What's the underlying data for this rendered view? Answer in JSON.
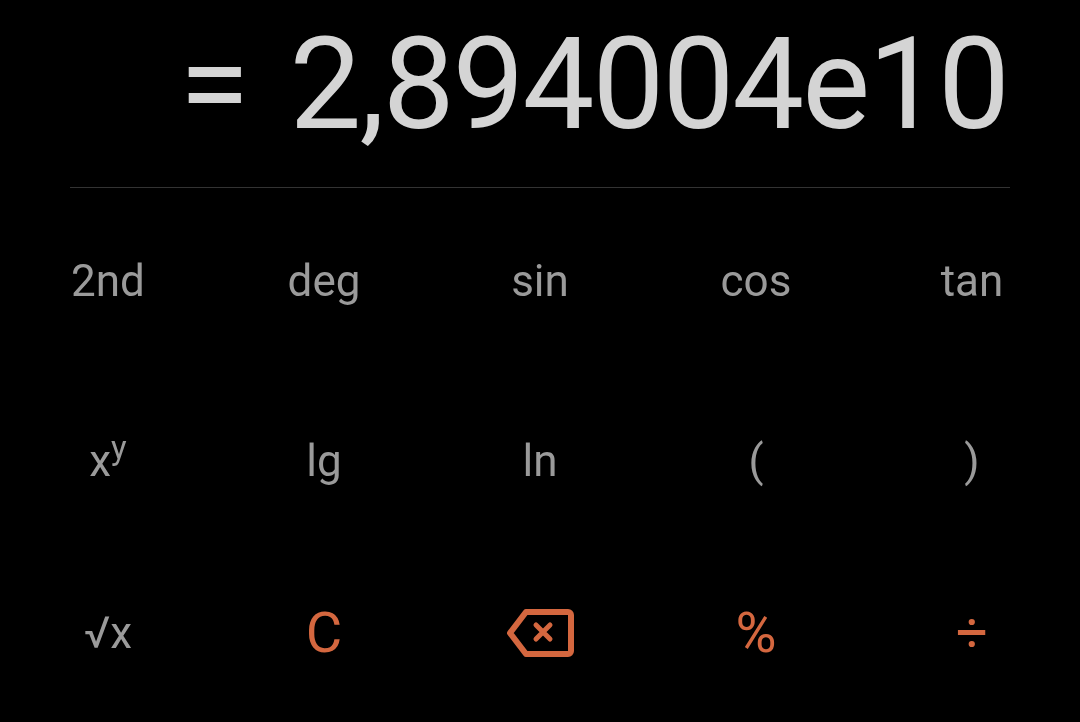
{
  "display": {
    "equals": "=",
    "result": "2,894004e10"
  },
  "keys": [
    {
      "label": "2nd",
      "kind": "function"
    },
    {
      "label": "deg",
      "kind": "function"
    },
    {
      "label": "sin",
      "kind": "function"
    },
    {
      "label": "cos",
      "kind": "function"
    },
    {
      "label": "tan",
      "kind": "function"
    },
    {
      "label": "x$^{y}$",
      "kind": "function"
    },
    {
      "label": "lg",
      "kind": "function"
    },
    {
      "label": "ln",
      "kind": "function"
    },
    {
      "label": "(",
      "kind": "function"
    },
    {
      "label": ")",
      "kind": "function"
    },
    {
      "label": "√x",
      "kind": "function"
    },
    {
      "label": "C",
      "kind": "operator"
    },
    {
      "kind": "backspace"
    },
    {
      "label": "%",
      "kind": "operator"
    },
    {
      "label": "÷",
      "kind": "operator"
    }
  ]
}
